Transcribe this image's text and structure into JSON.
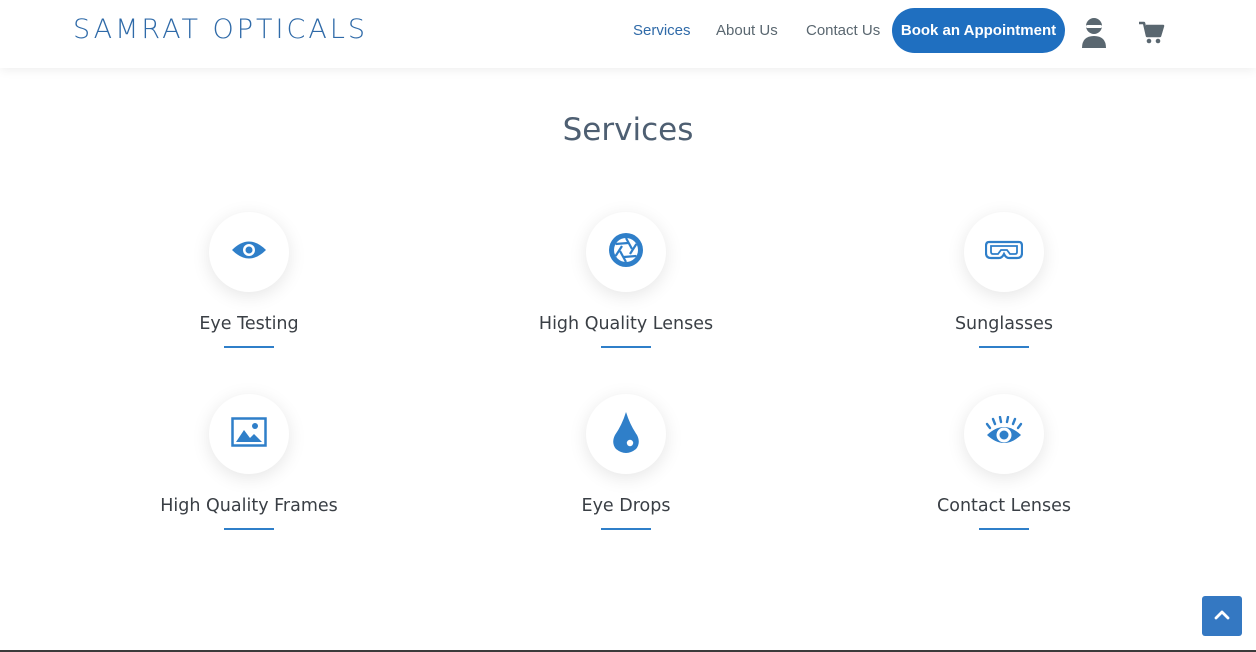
{
  "brand": {
    "logo": "SAMRAT OPTICALS"
  },
  "nav": {
    "items": [
      {
        "label": "Services",
        "active": true
      },
      {
        "label": "About Us",
        "active": false
      },
      {
        "label": "Contact Us",
        "active": false
      }
    ],
    "book_button": "Book an Appointment",
    "icons": [
      "user-icon",
      "cart-icon"
    ]
  },
  "services": {
    "title": "Services",
    "items": [
      {
        "label": "Eye Testing",
        "icon": "eye-icon"
      },
      {
        "label": "High Quality Lenses",
        "icon": "lens-aperture-icon"
      },
      {
        "label": "Sunglasses",
        "icon": "goggles-icon"
      },
      {
        "label": "High Quality Frames",
        "icon": "image-frame-icon"
      },
      {
        "label": "Eye Drops",
        "icon": "drop-icon"
      },
      {
        "label": "Contact Lenses",
        "icon": "eye-lashes-icon"
      }
    ]
  },
  "colors": {
    "accent": "#1f6fc0",
    "icon": "#2f7fc9",
    "title": "#4e5f72"
  }
}
